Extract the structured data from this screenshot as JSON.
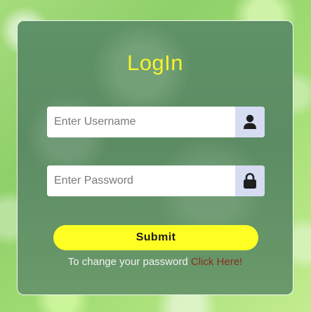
{
  "login_form": {
    "title": "LogIn",
    "username": {
      "placeholder": "Enter Username",
      "value": "",
      "icon": "user-icon"
    },
    "password": {
      "placeholder": "Enter Password",
      "value": "",
      "icon": "lock-icon"
    },
    "submit_label": "Submit",
    "footer": {
      "text": "To change your password",
      "link_text": "Click Here!"
    }
  },
  "colors": {
    "title": "#f7f22e",
    "submit_bg": "#ffff24",
    "icon_addon_bg": "#d6dcf2",
    "link": "#8b2e1e"
  }
}
